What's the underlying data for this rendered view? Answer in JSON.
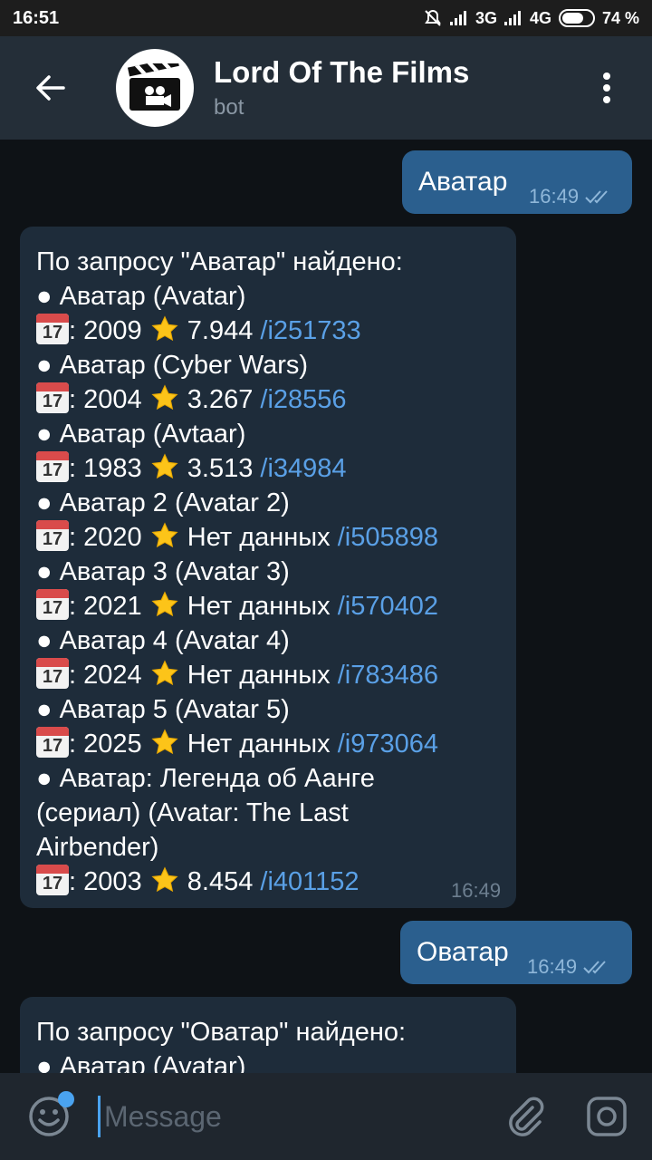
{
  "status": {
    "time": "16:51",
    "net1": "3G",
    "net2": "4G",
    "battery": "74 %",
    "battery_level": 0.74
  },
  "header": {
    "title": "Lord Of The Films",
    "subtitle": "bot"
  },
  "messages": {
    "out1": {
      "text": "Аватар",
      "time": "16:49"
    },
    "in1": {
      "time": "16:49",
      "lines": [
        {
          "text": "По запросу \"Аватар\" найдено:"
        },
        {
          "text": "● Аватар (Avatar)"
        },
        {
          "cal": "17",
          "year": ": 2009",
          "rating": " 7.944 ",
          "link": "/i251733"
        },
        {
          "text": "● Аватар (Cyber Wars)"
        },
        {
          "cal": "17",
          "year": ": 2004",
          "rating": " 3.267 ",
          "link": "/i28556"
        },
        {
          "text": "● Аватар (Avtaar)"
        },
        {
          "cal": "17",
          "year": ": 1983",
          "rating": " 3.513 ",
          "link": "/i34984"
        },
        {
          "text": "● Аватар 2 (Avatar 2)"
        },
        {
          "cal": "17",
          "year": ": 2020",
          "rating": " Нет данных ",
          "link": "/i505898"
        },
        {
          "text": "● Аватар 3 (Avatar 3)"
        },
        {
          "cal": "17",
          "year": ": 2021",
          "rating": " Нет данных ",
          "link": "/i570402"
        },
        {
          "text": "● Аватар 4 (Avatar 4)"
        },
        {
          "cal": "17",
          "year": ": 2024",
          "rating": " Нет данных ",
          "link": "/i783486"
        },
        {
          "text": "● Аватар 5 (Avatar 5)"
        },
        {
          "cal": "17",
          "year": ": 2025",
          "rating": " Нет данных ",
          "link": "/i973064"
        },
        {
          "text": "● Аватар: Легенда об Аанге"
        },
        {
          "text": "(сериал)  (Avatar: The Last"
        },
        {
          "text": "Airbender)"
        },
        {
          "cal": "17",
          "year": ": 2003",
          "rating": " 8.454 ",
          "link": "/i401152"
        }
      ]
    },
    "out2": {
      "text": "Оватар",
      "time": "16:49"
    },
    "in2": {
      "lines": [
        {
          "text": "По запросу \"Оватар\" найдено:"
        },
        {
          "text": "● Аватар (Avatar)"
        }
      ]
    }
  },
  "input": {
    "placeholder": "Message"
  },
  "icons": {
    "back": "arrow-left-icon",
    "menu": "kebab-menu-icon",
    "emoji": "smiley-icon",
    "attach": "paperclip-icon",
    "camera": "camera-icon",
    "read": "double-check-icon"
  },
  "colors": {
    "outgoing": "#2b5f8e",
    "incoming": "#1e2c3a",
    "link": "#5aa0e6",
    "header": "#242e38"
  }
}
